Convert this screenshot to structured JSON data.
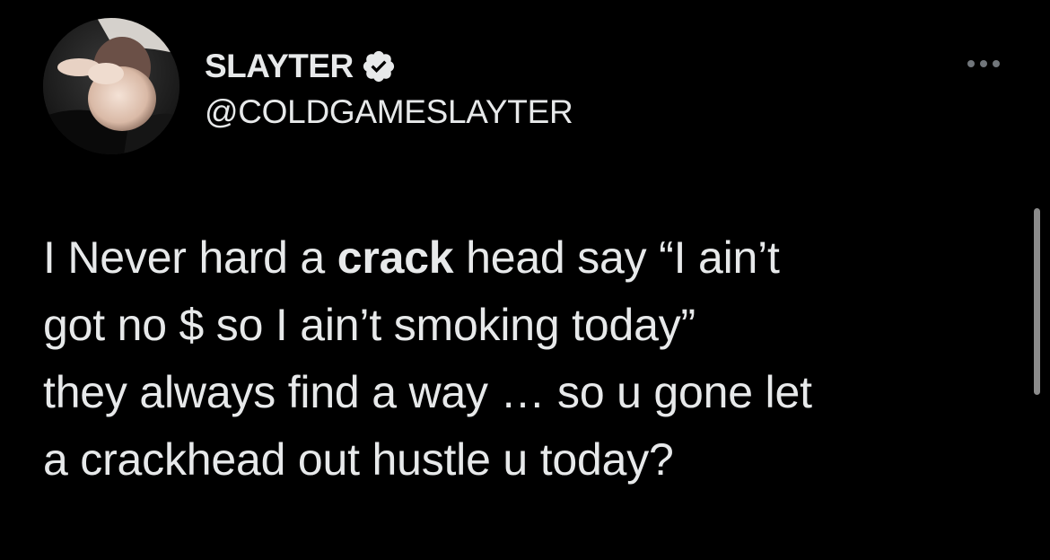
{
  "tweet": {
    "display_name": "SLAYTER",
    "handle": "@COLDGAMESLAYTER",
    "body": {
      "line1_a": "I Never hard a ",
      "line1_bold": "crack",
      "line1_b": " head say “I ain’t",
      "line2": "got no $ so I ain’t smoking today”",
      "line3": "they always find a way … so u gone let",
      "line4": "a crackhead out hustle u today?"
    }
  },
  "icons": {
    "verified": "verified-badge-icon",
    "more": "more-options-icon"
  },
  "colors": {
    "background": "#000000",
    "text": "#e7e9ea",
    "muted": "#71767b"
  }
}
